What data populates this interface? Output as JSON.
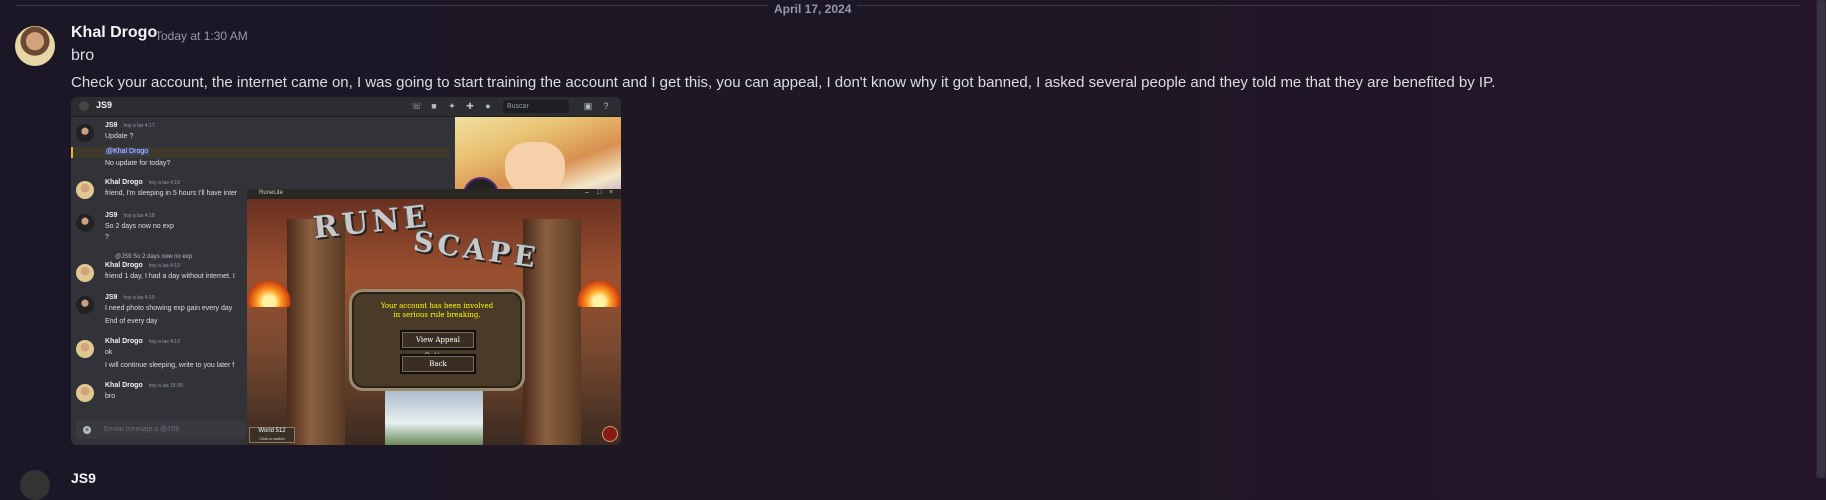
{
  "divider": {
    "date": "April 17, 2024"
  },
  "message": {
    "author": "Khal Drogo",
    "timestamp": "Today at 1:30 AM",
    "lines": [
      "bro",
      "Check your account, the internet came on, I was going to start training the account and I get this, you can appeal, I don't know why it got banned, I asked several people and they told me that they are benefited by IP."
    ]
  },
  "attachment": {
    "discord": {
      "channel": "JS9",
      "search_placeholder": "Buscar",
      "input_placeholder": "Enviar mensaje a @JS9",
      "messages": [
        {
          "author": "JS9",
          "time": "hoy a las 4:17",
          "lines": [
            "Update ?"
          ]
        },
        {
          "author": "",
          "time": "",
          "lines": [
            "@Khal Drogo",
            "No update for today?"
          ]
        },
        {
          "author": "Khal Drogo",
          "time": "hoy a las 4:18",
          "lines": [
            "friend, I'm sleeping in 5 hours I'll have inter"
          ]
        },
        {
          "author": "JS9",
          "time": "hoy a las 4:18",
          "lines": [
            "So 2 days now no exp",
            "?"
          ]
        },
        {
          "author": "",
          "time": "",
          "lines": [
            "@JS9 So 2 days now no exp"
          ]
        },
        {
          "author": "Khal Drogo",
          "time": "hoy a las 4:19",
          "lines": [
            "friend 1 day, I had a day without internet. I"
          ]
        },
        {
          "author": "JS9",
          "time": "hoy a las 4:19",
          "lines": [
            "I need photo showing exp gain every day",
            "End of every day"
          ]
        },
        {
          "author": "Khal Drogo",
          "time": "hoy a las 4:19",
          "lines": [
            "ok",
            "I will continue sleeping, write to you later f"
          ]
        },
        {
          "author": "Khal Drogo",
          "time": "hoy a las 15:30",
          "lines": [
            "bro"
          ]
        }
      ]
    },
    "runelite": {
      "title": "RuneLite",
      "logo_line1": "RUNE",
      "logo_line2": "SCAPE",
      "ban_line1": "Your account has been involved",
      "ban_line2": "in serious rule breaking.",
      "appeal_button": "View Appeal Options",
      "back_button": "Back",
      "world_label": "World 512",
      "world_sub": "Click to switch"
    }
  },
  "next_message": {
    "author": "JS9"
  }
}
